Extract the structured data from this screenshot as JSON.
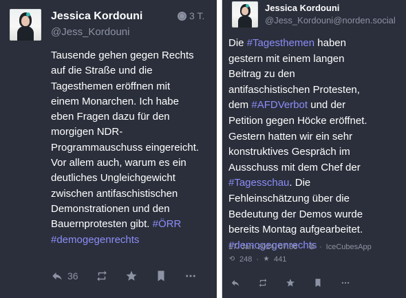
{
  "left_post": {
    "name": "Jessica Kordouni",
    "handle": "@Jess_Kordouni",
    "time_ago": "3 T.",
    "text_lines": [
      "Tausende gehen gegen Rechts",
      "auf die Straße und die",
      "Tagesthemen eröffnen mit",
      "einem Monarchen. Ich habe",
      "eben Fragen dazu für den",
      "morgigen NDR-",
      "Programmauschuss eingereicht.",
      "Vor allem auch, warum es ein",
      "deutliches Ungleichgewicht",
      "zwischen antifaschistischen",
      "Demonstrationen und den",
      "Bauernprotesten gibt. #ÖRR",
      "#demogegenrechts"
    ],
    "reply_count": "36",
    "icons": {
      "reply": "reply-icon",
      "boost": "boost-icon",
      "favorite": "star-icon",
      "bookmark": "bookmark-icon",
      "more": "more-icon",
      "visibility": "globe-icon"
    }
  },
  "right_post": {
    "name": "Jessica Kordouni",
    "handle": "@Jess_Kordouni@norden.social",
    "text_lines": [
      "Die #Tagesthemen haben",
      "gestern mit einem langen",
      "Beitrag zu den",
      "antifaschistischen Protesten,",
      "dem #AFDVerbot und der",
      "Petition gegen Höcke eröffnet.",
      "Gestern hatten wir ein sehr",
      "konstruktives Gespräch im",
      "Ausschuss mit dem Chef der",
      "#Tagesschau. Die",
      "Fehleinschätzung über die",
      "Bedeutung der Demos wurde",
      "bereits Montag aufgearbeitet.",
      "#demogegenrechts"
    ],
    "meta_date": "17. Jan. 2024, 07:36",
    "meta_client": "IceCubesApp",
    "boost_count": "248",
    "favorite_count": "441",
    "icons": {
      "reply": "reply-icon",
      "boost": "boost-icon",
      "favorite": "star-icon",
      "bookmark": "bookmark-icon",
      "more": "more-icon",
      "visibility": "globe-icon"
    }
  },
  "colors": {
    "card_background": "#2b2f3b",
    "text_primary": "#ffffff",
    "text_secondary": "#8d93a4",
    "hashtag": "#8c8df9"
  }
}
